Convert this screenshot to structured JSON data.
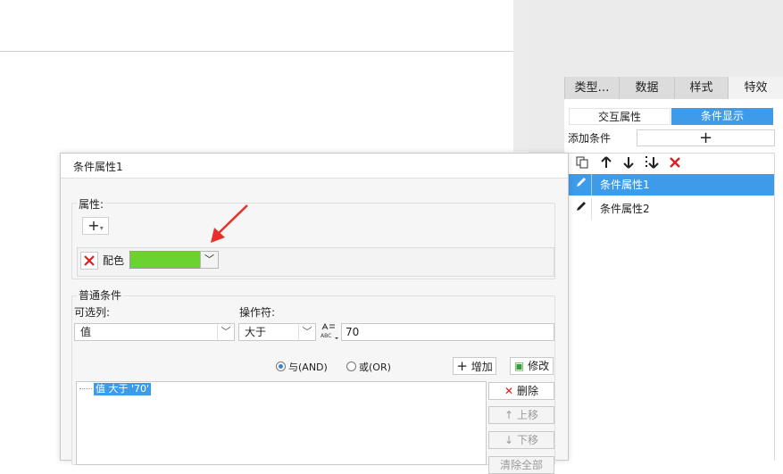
{
  "panel": {
    "tabs": [
      "类型…",
      "数据",
      "样式",
      "特效"
    ],
    "segments": [
      "交互属性",
      "条件显示"
    ],
    "add_condition_label": "添加条件",
    "add_condition_symbol": "+",
    "toolbar_icons": [
      "copy-icon",
      "move-up-icon",
      "move-down-icon",
      "move-bottom-icon",
      "delete-icon"
    ],
    "conditions": [
      "条件属性1",
      "条件属性2"
    ],
    "selected_condition_index": 0
  },
  "dialog": {
    "title": "条件属性1",
    "property_group": {
      "label": "属性:",
      "add_symbol": "+",
      "property_label": "配色",
      "color_value": "#6ad331"
    },
    "normal_condition": {
      "label": "普通条件",
      "column_label": "可选列:",
      "column_value": "值",
      "operator_label": "操作符:",
      "operator_value": "大于",
      "value_type_icon": "ABC",
      "value": "70",
      "radio_and": "与(AND)",
      "radio_or": "或(OR)",
      "selected_radio": "and",
      "add_button": "增加",
      "edit_button": "修改",
      "tree_item": "值 大于 '70'",
      "delete_button": "删除",
      "up_button": "上移",
      "down_button": "下移",
      "clear_button": "清除全部"
    }
  },
  "colors": {
    "accent": "#3d9be9",
    "delete_red": "#e02020",
    "arrow_red": "#e8302a"
  }
}
